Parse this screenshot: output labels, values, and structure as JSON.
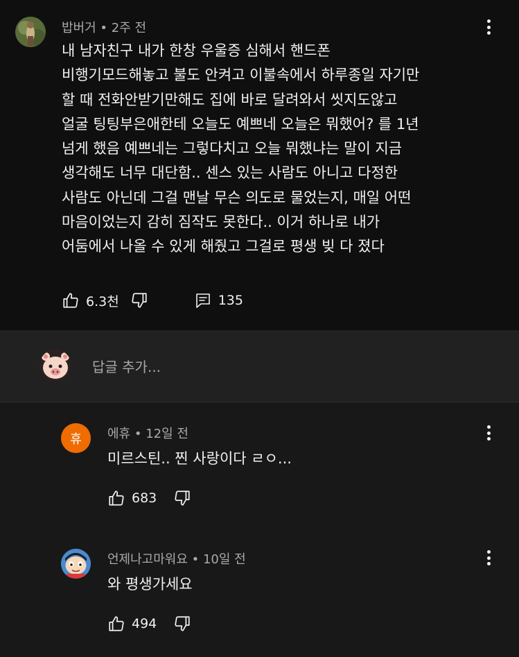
{
  "comment": {
    "author": "밥버거",
    "time": "2주 전",
    "lines": [
      "내 남자친구 내가 한창 우울증 심해서 핸드폰",
      "비행기모드해놓고 불도 안켜고 이불속에서 하루종일 자기만",
      "할 때 전화안받기만해도 집에 바로 달려와서 씻지도않고",
      "얼굴 팅팅부은애한테 오늘도 예쁘네 오늘은 뭐했어? 를 1년",
      "넘게 했음 예쁘네는 그렇다치고 오늘 뭐했냐는 말이 지금",
      "생각해도 너무 대단함.. 센스 있는 사람도 아니고 다정한",
      "사람도 아닌데 그걸 맨날 무슨 의도로 물었는지, 매일 어떤",
      "마음이었는지 감히 짐작도 못한다..  이거 하나로 내가",
      "어둠에서 나올 수 있게 해줬고 그걸로 평생 빚 다 졌다"
    ],
    "likes": "6.3천",
    "replies": "135"
  },
  "reply_input": {
    "placeholder": "답글 추가..."
  },
  "replies": [
    {
      "author": "에휴",
      "time": "12일 전",
      "avatar_letter": "휴",
      "avatar_color": "#ef6c00",
      "text": "미르스틴.. 찐 사랑이다 ㄹㅇ...",
      "likes": "683"
    },
    {
      "author": "언제나고마워요",
      "time": "10일 전",
      "text": "와 평생가세요",
      "likes": "494"
    }
  ],
  "colors": {
    "background": "#181818",
    "top_background": "#0f0f0f",
    "input_background": "#212121",
    "text": "#f1f1f1",
    "secondary_text": "#aaaaaa"
  }
}
